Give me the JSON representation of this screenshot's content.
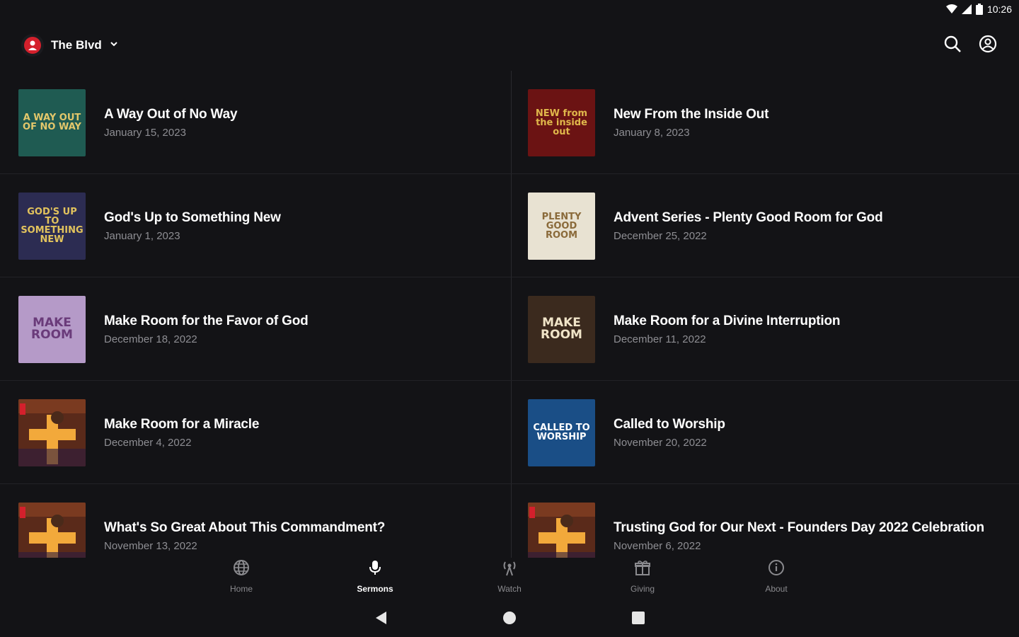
{
  "status": {
    "time": "10:26"
  },
  "app": {
    "org_name": "The Blvd"
  },
  "sermons": [
    {
      "title": "A Way Out of No Way",
      "date": "January 15, 2023",
      "thumb": {
        "bg": "#1f5b52",
        "fg": "#e3c76b",
        "text": "A WAY OUT OF NO WAY"
      }
    },
    {
      "title": "New From the Inside Out",
      "date": "January 8, 2023",
      "thumb": {
        "bg": "#6b1313",
        "fg": "#e0b84b",
        "text": "NEW from the inside out"
      }
    },
    {
      "title": "God's Up to Something New",
      "date": "January 1, 2023",
      "thumb": {
        "bg": "#2c2c52",
        "fg": "#e2c35d",
        "text": "GOD'S UP TO SOMETHING NEW"
      }
    },
    {
      "title": "Advent Series - Plenty Good Room for God",
      "date": "December 25, 2022",
      "thumb": {
        "bg": "#e8e2d2",
        "fg": "#8a6a3a",
        "text": "PLENTY GOOD ROOM"
      }
    },
    {
      "title": "Make Room for the Favor of God",
      "date": "December 18, 2022",
      "thumb": {
        "bg": "#b59ac8",
        "fg": "#6a3b7a",
        "text": "MAKE ROOM"
      }
    },
    {
      "title": "Make Room for a Divine Interruption",
      "date": "December 11, 2022",
      "thumb": {
        "bg": "#3b2a1e",
        "fg": "#f0e4c8",
        "text": "MAKE ROOM"
      }
    },
    {
      "title": "Make Room for a Miracle",
      "date": "December 4, 2022",
      "thumb": {
        "bg": "#5a2a1a",
        "fg": "#f2a93b",
        "text": ""
      }
    },
    {
      "title": "Called to Worship",
      "date": "November 20, 2022",
      "thumb": {
        "bg": "#1a4e86",
        "fg": "#ffffff",
        "text": "CALLED TO WORSHIP"
      }
    },
    {
      "title": "What's So Great About This Commandment?",
      "date": "November 13, 2022",
      "thumb": {
        "bg": "#5a2a1a",
        "fg": "#f2a93b",
        "text": ""
      }
    },
    {
      "title": "Trusting God for Our Next - Founders Day 2022 Celebration",
      "date": "November 6, 2022",
      "thumb": {
        "bg": "#5a2a1a",
        "fg": "#f2a93b",
        "text": ""
      }
    }
  ],
  "nav": {
    "home": "Home",
    "sermons": "Sermons",
    "watch": "Watch",
    "giving": "Giving",
    "about": "About"
  },
  "colors": {
    "background": "#131316",
    "muted": "#8e8e93",
    "accent": "#d4202c"
  }
}
